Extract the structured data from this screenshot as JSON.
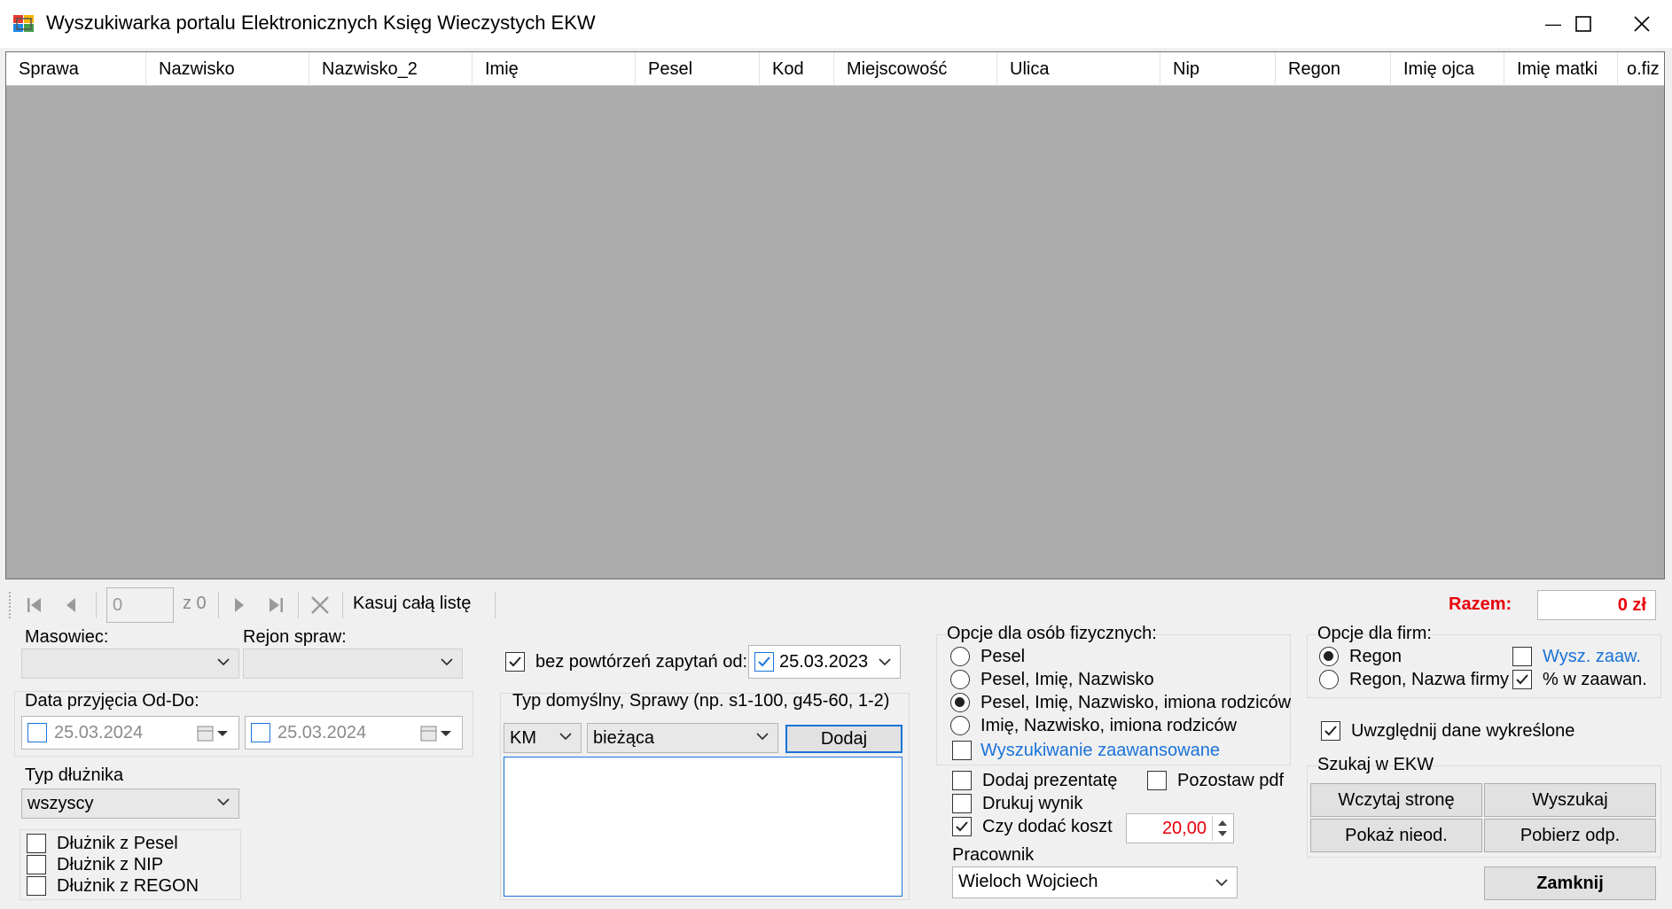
{
  "window": {
    "title": "Wyszukiwarka portalu Elektronicznych Księg Wieczystych EKW",
    "minimize_glyph": "—",
    "maximize_glyph": "☐",
    "close_glyph": "✕"
  },
  "grid": {
    "columns": [
      "Sprawa",
      "Nazwisko",
      "Nazwisko_2",
      "Imię",
      "Pesel",
      "Kod",
      "Miejscowość",
      "Ulica",
      "Nip",
      "Regon",
      "Imię ojca",
      "Imię matki",
      "o.fiz"
    ]
  },
  "navigator": {
    "page_value": "0",
    "page_of": "z 0",
    "clear_all": "Kasuj całą listę",
    "total_label": "Razem:",
    "total_value": "0 zł"
  },
  "filters": {
    "masowiec_label": "Masowiec:",
    "rejon_label": "Rejon spraw:",
    "date_range_label": "Data przyjęcia Od-Do:",
    "date_from": "25.03.2024",
    "date_to": "25.03.2024",
    "debtor_type_label": "Typ dłużnika",
    "debtor_type_value": "wszyscy",
    "debtor_pesel": "Dłużnik z Pesel",
    "debtor_nip": "Dłużnik z NIP",
    "debtor_regon": "Dłużnik z REGON"
  },
  "query": {
    "no_repeat_label": "bez powtórzeń zapytań od:",
    "no_repeat_date": "25.03.2023",
    "default_type_label": "Typ domyślny, Sprawy (np. s1-100, g45-60, 1-2)",
    "type_value": "KM",
    "status_value": "bieżąca",
    "add_button": "Dodaj",
    "cases_text": ""
  },
  "person_options": {
    "label": "Opcje dla osób fizycznych:",
    "options": [
      "Pesel",
      "Pesel, Imię, Nazwisko",
      "Pesel, Imię, Nazwisko, imiona rodziców",
      "Imię, Nazwisko, imiona rodziców"
    ],
    "selected": 2,
    "advanced": "Wyszukiwanie zaawansowane"
  },
  "extra": {
    "add_presenter": "Dodaj prezentatę",
    "keep_pdf": "Pozostaw pdf",
    "print_result": "Drukuj wynik",
    "add_cost": "Czy dodać koszt",
    "cost_value": "20,00",
    "employee_label": "Pracownik",
    "employee_value": "Wieloch Wojciech"
  },
  "company_options": {
    "label": "Opcje dla firm:",
    "regon": "Regon",
    "regon_name": "Regon, Nazwa firmy",
    "adv_search": "Wysz. zaaw.",
    "percent_adv": "% w zaawan.",
    "include_deleted": "Uwzględnij dane wykreślone"
  },
  "ekw": {
    "label": "Szukaj w EKW",
    "load_page": "Wczytaj stronę",
    "search": "Wyszukaj",
    "show_unread": "Pokaż nieod.",
    "fetch_copy": "Pobierz odp.",
    "close": "Zamknij"
  },
  "colors": {
    "grid_bg": "#ababab",
    "total_red": "#e8000b",
    "link_blue": "#1a73d9",
    "date_check_blue": "#1a73d9"
  }
}
